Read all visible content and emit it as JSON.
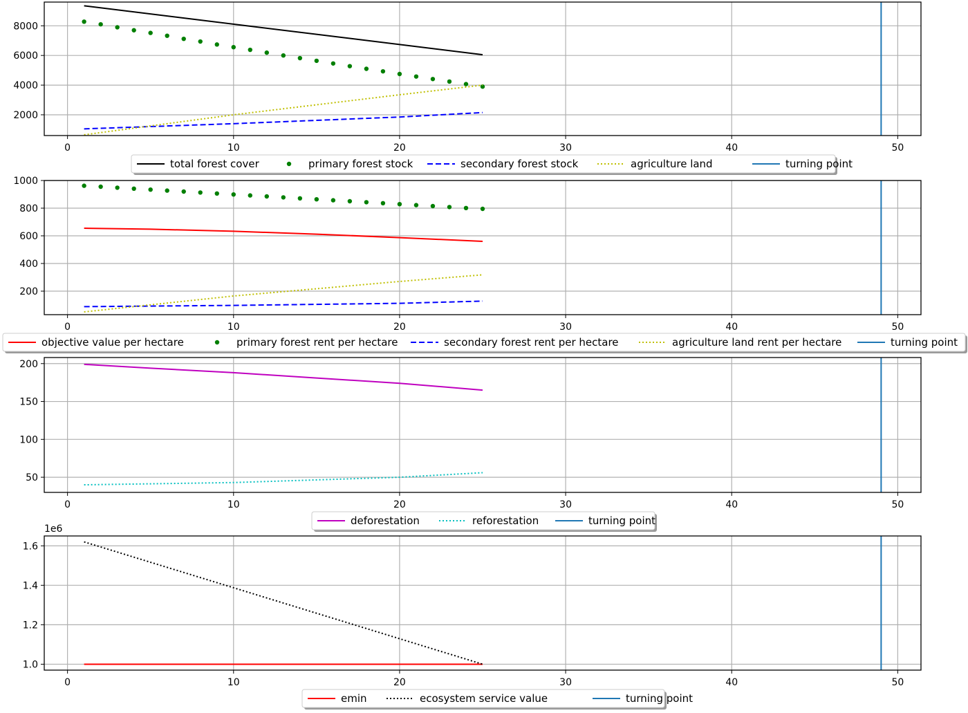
{
  "figure": {
    "colors": {
      "grid": "#b0b0b0",
      "axes": "#000000",
      "legend_border": "#cccccc",
      "legend_shadow": "#9a9a9a"
    }
  },
  "chart_data": [
    {
      "type": "line",
      "xlim": [
        -1.4,
        51.4
      ],
      "ylim": [
        600,
        9600
      ],
      "xticks": [
        0,
        10,
        20,
        30,
        40,
        50
      ],
      "yticks": [
        2000,
        4000,
        6000,
        8000
      ],
      "grid": true,
      "legend_placement": "below",
      "series": [
        {
          "name": "total forest cover",
          "style": "solid",
          "color": "#000000",
          "x": [
            1,
            25
          ],
          "y": [
            9350,
            6050
          ]
        },
        {
          "name": "primary forest stock",
          "style": "dots",
          "color": "#007f00",
          "x": [
            1,
            2,
            3,
            4,
            5,
            6,
            7,
            8,
            9,
            10,
            11,
            12,
            13,
            14,
            15,
            16,
            17,
            18,
            19,
            20,
            21,
            22,
            23,
            24,
            25
          ],
          "y": [
            8280,
            8100,
            7900,
            7700,
            7520,
            7330,
            7120,
            6940,
            6740,
            6560,
            6380,
            6190,
            6000,
            5820,
            5640,
            5460,
            5280,
            5100,
            4930,
            4750,
            4580,
            4410,
            4240,
            4070,
            3900
          ]
        },
        {
          "name": "secondary forest stock",
          "style": "dashed",
          "color": "#0000ff",
          "x": [
            1,
            10,
            20,
            25
          ],
          "y": [
            1050,
            1400,
            1850,
            2150
          ]
        },
        {
          "name": "agriculture land",
          "style": "dotted",
          "color": "#bfbf00",
          "x": [
            1,
            10,
            20,
            25
          ],
          "y": [
            650,
            2000,
            3350,
            4000
          ]
        },
        {
          "name": "turning point",
          "style": "vline",
          "color": "#1f77b4",
          "x": [
            49,
            49
          ],
          "y": [
            600,
            9600
          ]
        }
      ]
    },
    {
      "type": "line",
      "xlim": [
        -1.4,
        51.4
      ],
      "ylim": [
        30,
        1000
      ],
      "xticks": [
        0,
        10,
        20,
        30,
        40,
        50
      ],
      "yticks": [
        200,
        400,
        600,
        800,
        1000
      ],
      "grid": true,
      "legend_placement": "below",
      "series": [
        {
          "name": "objective value per hectare",
          "style": "solid",
          "color": "#ff0000",
          "x": [
            1,
            5,
            10,
            15,
            20,
            25
          ],
          "y": [
            655,
            648,
            633,
            612,
            587,
            560
          ]
        },
        {
          "name": "primary forest rent per hectare",
          "style": "dots",
          "color": "#007f00",
          "x": [
            1,
            2,
            3,
            4,
            5,
            6,
            7,
            8,
            9,
            10,
            11,
            12,
            13,
            14,
            15,
            16,
            17,
            18,
            19,
            20,
            21,
            22,
            23,
            24,
            25
          ],
          "y": [
            962,
            955,
            948,
            941,
            934,
            927,
            920,
            913,
            906,
            899,
            892,
            885,
            878,
            871,
            864,
            857,
            850,
            843,
            836,
            829,
            822,
            815,
            808,
            801,
            795
          ]
        },
        {
          "name": "secondary forest rent per hectare",
          "style": "dashed",
          "color": "#0000ff",
          "x": [
            1,
            10,
            20,
            25
          ],
          "y": [
            88,
            97,
            112,
            128
          ]
        },
        {
          "name": "agriculture land rent per hectare",
          "style": "dotted",
          "color": "#bfbf00",
          "x": [
            1,
            10,
            20,
            25
          ],
          "y": [
            50,
            165,
            270,
            318
          ]
        },
        {
          "name": "turning point",
          "style": "vline",
          "color": "#1f77b4",
          "x": [
            49,
            49
          ],
          "y": [
            30,
            1000
          ]
        }
      ]
    },
    {
      "type": "line",
      "xlim": [
        -1.4,
        51.4
      ],
      "ylim": [
        30,
        208
      ],
      "xticks": [
        0,
        10,
        20,
        30,
        40,
        50
      ],
      "yticks": [
        50,
        100,
        150,
        200
      ],
      "grid": true,
      "legend_placement": "below",
      "series": [
        {
          "name": "deforestation",
          "style": "solid",
          "color": "#bf00bf",
          "x": [
            1,
            5,
            10,
            15,
            20,
            25
          ],
          "y": [
            199,
            194,
            188,
            181,
            174,
            165
          ]
        },
        {
          "name": "reforestation",
          "style": "dotted",
          "color": "#00bfbf",
          "x": [
            1,
            10,
            20,
            25
          ],
          "y": [
            40,
            43,
            50,
            56
          ]
        },
        {
          "name": "turning point",
          "style": "vline",
          "color": "#1f77b4",
          "x": [
            49,
            49
          ],
          "y": [
            30,
            208
          ]
        }
      ]
    },
    {
      "type": "line",
      "xlim": [
        -1.4,
        51.4
      ],
      "ylim": [
        0.97,
        1.65
      ],
      "yscale_label": "1e6",
      "xticks": [
        0,
        10,
        20,
        30,
        40,
        50
      ],
      "yticks": [
        1.0,
        1.2,
        1.4,
        1.6
      ],
      "ytick_labels": [
        "1.0",
        "1.2",
        "1.4",
        "1.6"
      ],
      "grid": true,
      "legend_placement": "below",
      "series": [
        {
          "name": "emin",
          "style": "solid",
          "color": "#ff0000",
          "x": [
            1,
            25
          ],
          "y": [
            1.0,
            1.0
          ]
        },
        {
          "name": "ecosystem service value",
          "style": "dotted",
          "color": "#000000",
          "x": [
            1,
            25
          ],
          "y": [
            1.62,
            1.0
          ]
        },
        {
          "name": "turning point",
          "style": "vline",
          "color": "#1f77b4",
          "x": [
            49,
            49
          ],
          "y": [
            0.97,
            1.65
          ]
        }
      ]
    }
  ]
}
